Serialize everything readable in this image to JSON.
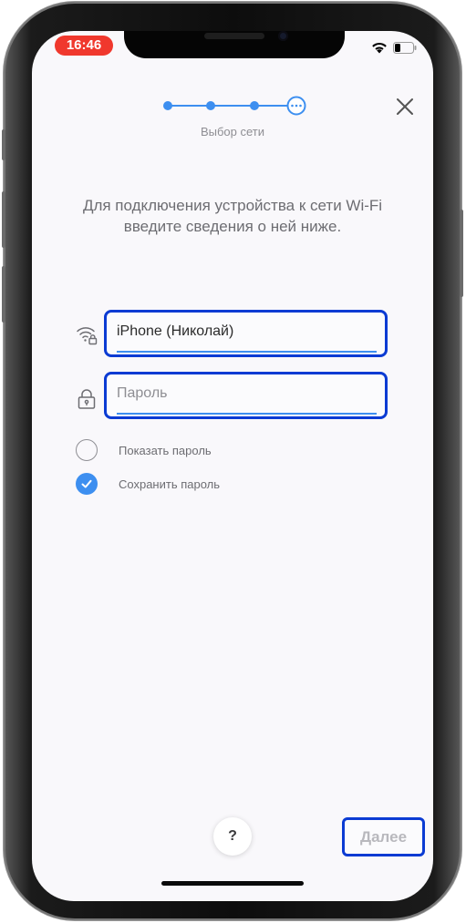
{
  "status_bar": {
    "time": "16:46"
  },
  "header": {
    "step_label": "Выбор сети",
    "steps_total": 4,
    "current_step": 4
  },
  "intro_text": "Для подключения устройства к сети Wi-Fi введите сведения о ней ниже.",
  "network_field": {
    "value": "iPhone (Николай)",
    "icon": "wifi-lock-icon"
  },
  "password_field": {
    "placeholder": "Пароль",
    "value": "",
    "icon": "lock-icon"
  },
  "options": {
    "show_password": {
      "label": "Показать пароль",
      "checked": false
    },
    "save_password": {
      "label": "Сохранить пароль",
      "checked": true
    }
  },
  "footer": {
    "help_label": "?",
    "next_label": "Далее"
  },
  "colors": {
    "accent": "#3d8ff0",
    "highlight_border": "#0b3bd3",
    "time_pill": "#f0382d"
  }
}
